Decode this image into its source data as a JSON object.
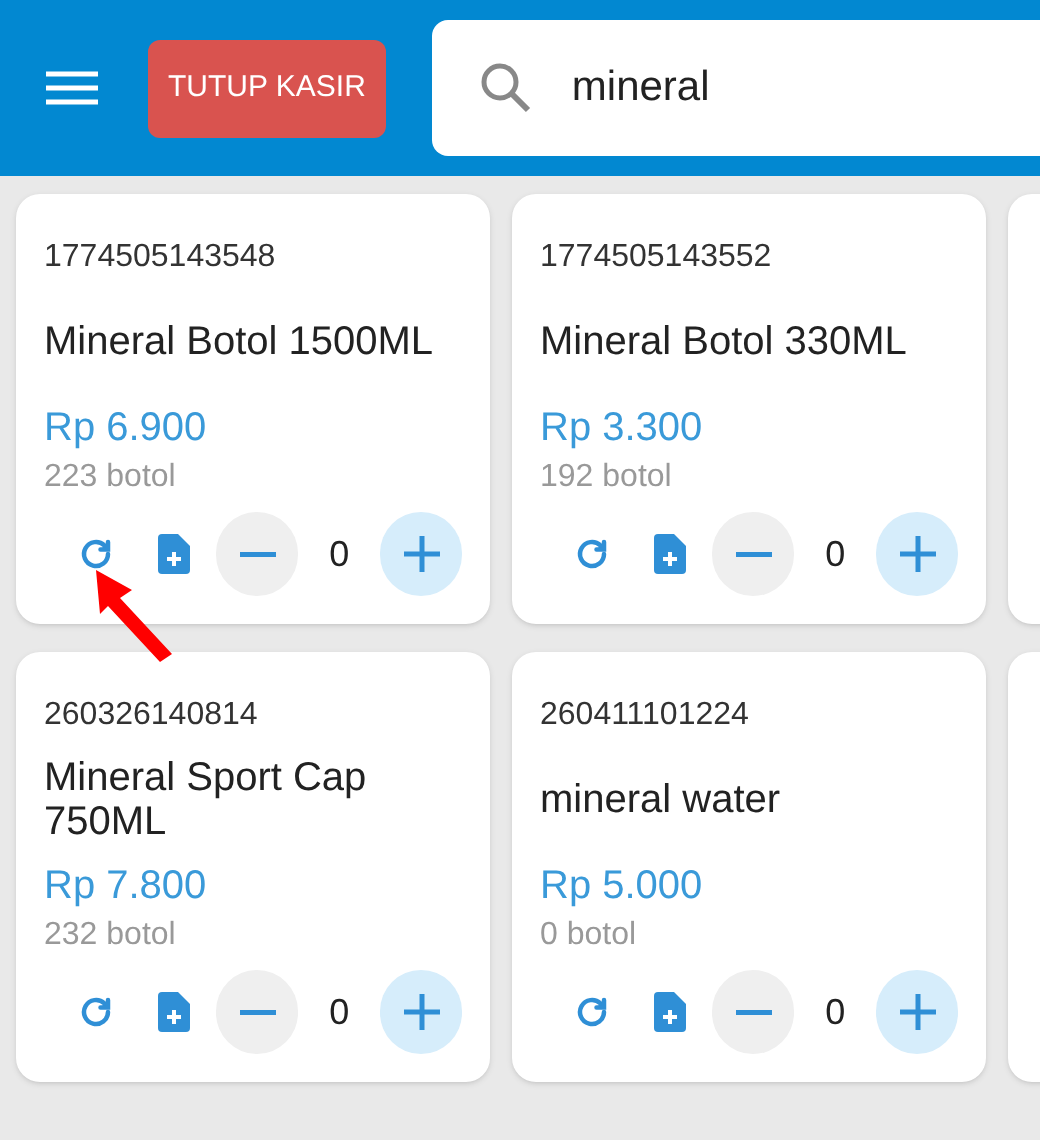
{
  "header": {
    "close_button": "TUTUP KASIR",
    "search": {
      "value": "mineral"
    }
  },
  "products": [
    {
      "barcode": "1774505143548",
      "name": "Mineral Botol 1500ML",
      "price": "Rp 6.900",
      "stock": "223 botol",
      "quantity": "0"
    },
    {
      "barcode": "1774505143552",
      "name": "Mineral Botol 330ML",
      "price": "Rp 3.300",
      "stock": "192 botol",
      "quantity": "0"
    },
    {
      "barcode": "260326140814",
      "name": "Mineral Sport Cap 750ML",
      "price": "Rp 7.800",
      "stock": "232 botol",
      "quantity": "0"
    },
    {
      "barcode": "260411101224",
      "name": "mineral water",
      "price": "Rp 5.000",
      "stock": "0 botol",
      "quantity": "0"
    }
  ]
}
